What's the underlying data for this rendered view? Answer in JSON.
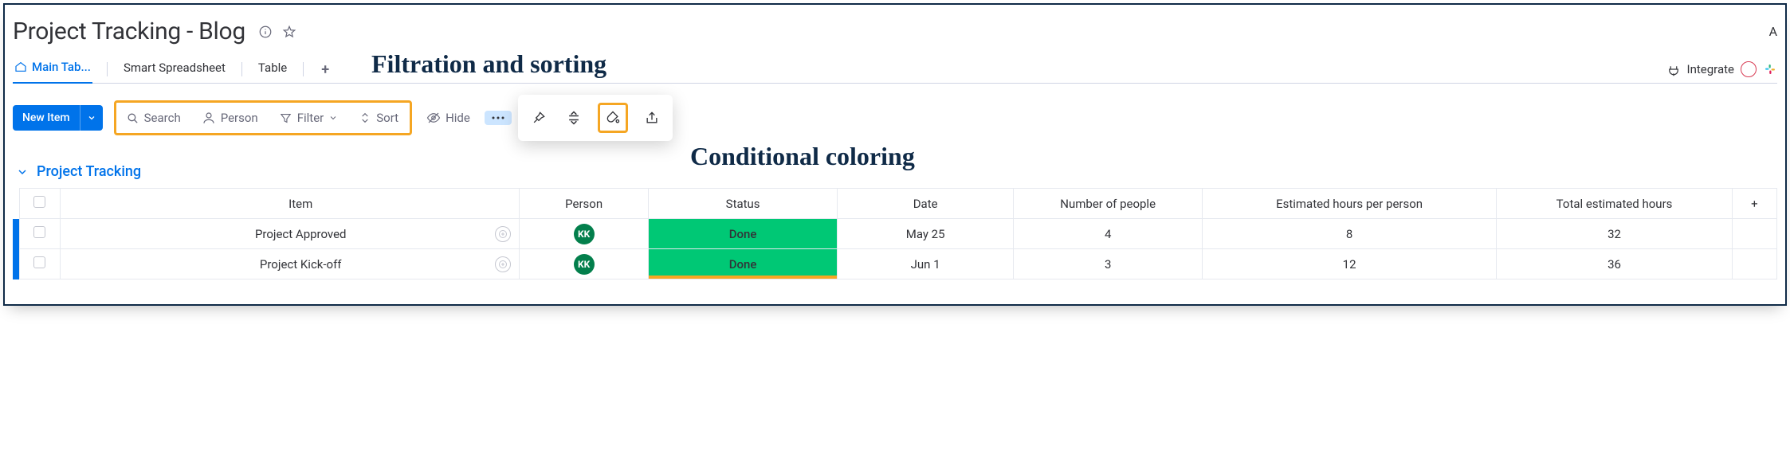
{
  "header": {
    "title": "Project Tracking - Blog",
    "right_edge": "A"
  },
  "tabs": {
    "items": [
      {
        "label": "Main Tab..."
      },
      {
        "label": "Smart Spreadsheet"
      },
      {
        "label": "Table"
      }
    ],
    "integrate_label": "Integrate"
  },
  "toolbar": {
    "new_item_label": "New Item",
    "search_label": "Search",
    "person_label": "Person",
    "filter_label": "Filter",
    "sort_label": "Sort",
    "hide_label": "Hide"
  },
  "annotations": {
    "filtration": "Filtration and sorting",
    "conditional": "Conditional coloring"
  },
  "group": {
    "title": "Project Tracking"
  },
  "table": {
    "columns": {
      "item": "Item",
      "person": "Person",
      "status": "Status",
      "date": "Date",
      "num_people": "Number of people",
      "est_hours": "Estimated hours per person",
      "total_hours": "Total estimated hours"
    },
    "rows": [
      {
        "item": "Project Approved",
        "person": "KK",
        "status": "Done",
        "date": "May 25",
        "num_people": "4",
        "est_hours": "8",
        "total_hours": "32"
      },
      {
        "item": "Project Kick-off",
        "person": "KK",
        "status": "Done",
        "date": "Jun 1",
        "num_people": "3",
        "est_hours": "12",
        "total_hours": "36"
      }
    ]
  },
  "colors": {
    "accent_blue": "#0073ea",
    "status_done": "#00c875",
    "highlight_orange": "#f5a623",
    "avatar_green": "#037f4c",
    "frame_navy": "#0f2a47"
  }
}
